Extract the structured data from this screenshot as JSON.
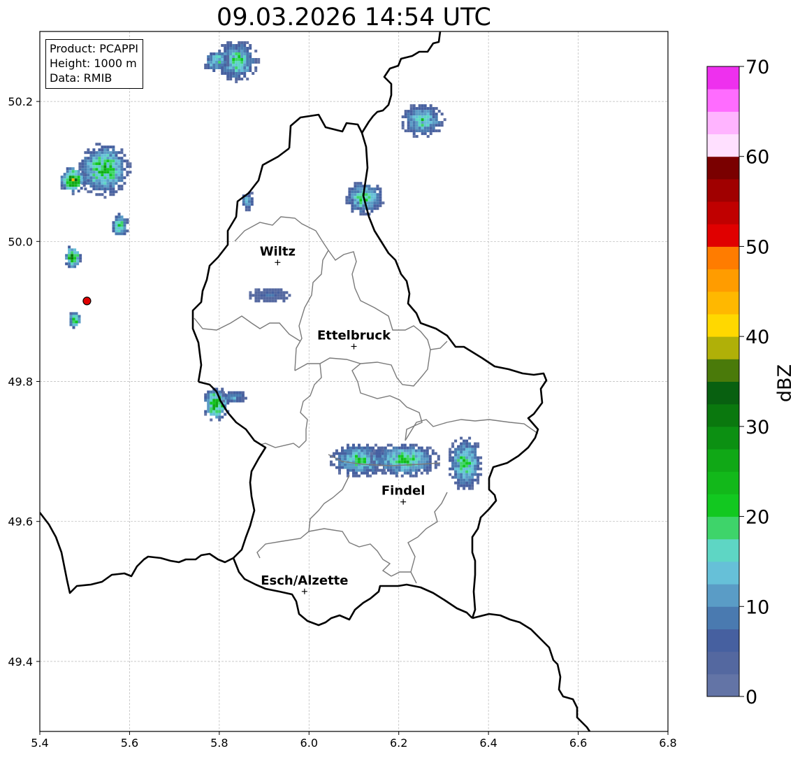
{
  "title": "09.03.2026 14:54 UTC",
  "info_box": {
    "product": "Product: PCAPPI",
    "height": "Height: 1000 m",
    "data": "Data: RMIB"
  },
  "map": {
    "x_axis": {
      "range": [
        5.4,
        6.8
      ],
      "ticks": [
        "5.4",
        "5.6",
        "5.8",
        "6.0",
        "6.2",
        "6.4",
        "6.6",
        "6.8"
      ],
      "tick_values": [
        5.4,
        5.6,
        5.8,
        6.0,
        6.2,
        6.4,
        6.6,
        6.8
      ]
    },
    "y_axis": {
      "range": [
        49.3,
        50.3
      ],
      "ticks": [
        "49.4",
        "49.6",
        "49.8",
        "50.0",
        "50.2"
      ],
      "tick_values": [
        49.4,
        49.6,
        49.8,
        50.0,
        50.2
      ]
    },
    "grid": true,
    "cities": [
      {
        "name": "Wiltz",
        "lon": 5.93,
        "lat": 49.97
      },
      {
        "name": "Ettelbruck",
        "lon": 6.1,
        "lat": 49.85
      },
      {
        "name": "Findel",
        "lon": 6.21,
        "lat": 49.628
      },
      {
        "name": "Esch/Alzette",
        "lon": 5.99,
        "lat": 49.5
      }
    ],
    "radar_site": {
      "lon": 5.505,
      "lat": 49.915,
      "color": "#e00000"
    },
    "echo_cells": [
      {
        "lon": 5.54,
        "lat": 50.105,
        "rx": 0.06,
        "ry": 0.04,
        "max_dbz": 28
      },
      {
        "lon": 5.47,
        "lat": 50.09,
        "rx": 0.03,
        "ry": 0.02,
        "max_dbz": 40
      },
      {
        "lon": 5.575,
        "lat": 50.025,
        "rx": 0.02,
        "ry": 0.02,
        "max_dbz": 25
      },
      {
        "lon": 5.47,
        "lat": 49.98,
        "rx": 0.02,
        "ry": 0.018,
        "max_dbz": 38
      },
      {
        "lon": 5.475,
        "lat": 49.89,
        "rx": 0.015,
        "ry": 0.013,
        "max_dbz": 32
      },
      {
        "lon": 5.79,
        "lat": 49.77,
        "rx": 0.03,
        "ry": 0.025,
        "max_dbz": 36
      },
      {
        "lon": 5.83,
        "lat": 49.78,
        "rx": 0.03,
        "ry": 0.01,
        "max_dbz": 15
      },
      {
        "lon": 5.835,
        "lat": 50.26,
        "rx": 0.05,
        "ry": 0.03,
        "max_dbz": 25
      },
      {
        "lon": 5.79,
        "lat": 50.26,
        "rx": 0.03,
        "ry": 0.018,
        "max_dbz": 22
      },
      {
        "lon": 6.25,
        "lat": 50.175,
        "rx": 0.05,
        "ry": 0.025,
        "max_dbz": 22
      },
      {
        "lon": 6.12,
        "lat": 50.064,
        "rx": 0.045,
        "ry": 0.025,
        "max_dbz": 25
      },
      {
        "lon": 5.86,
        "lat": 50.06,
        "rx": 0.015,
        "ry": 0.015,
        "max_dbz": 18
      },
      {
        "lon": 6.11,
        "lat": 49.69,
        "rx": 0.07,
        "ry": 0.025,
        "max_dbz": 24
      },
      {
        "lon": 6.21,
        "lat": 49.69,
        "rx": 0.08,
        "ry": 0.025,
        "max_dbz": 26
      },
      {
        "lon": 6.345,
        "lat": 49.685,
        "rx": 0.04,
        "ry": 0.04,
        "max_dbz": 25
      },
      {
        "lon": 5.91,
        "lat": 49.925,
        "rx": 0.05,
        "ry": 0.012,
        "max_dbz": 8
      }
    ]
  },
  "colorbar": {
    "label": "dBZ",
    "min": 0,
    "max": 70,
    "ticks": [
      "0",
      "10",
      "20",
      "30",
      "40",
      "50",
      "60",
      "70"
    ],
    "tick_values": [
      0,
      10,
      20,
      30,
      40,
      50,
      60,
      70
    ],
    "colors": [
      "#6374a6",
      "#5468a0",
      "#4660a0",
      "#4a7ab0",
      "#5a9cc6",
      "#66c0d8",
      "#5ed6c4",
      "#3ed46a",
      "#12c820",
      "#12b81a",
      "#10a816",
      "#0c9012",
      "#0a780e",
      "#086010",
      "#4a7a0a",
      "#b0b008",
      "#ffd800",
      "#ffb800",
      "#ff9c00",
      "#ff7c00",
      "#e00000",
      "#c00000",
      "#a00000",
      "#7a0000",
      "#ffe0ff",
      "#ffb4ff",
      "#ff6cff",
      "#ee30ee"
    ]
  }
}
